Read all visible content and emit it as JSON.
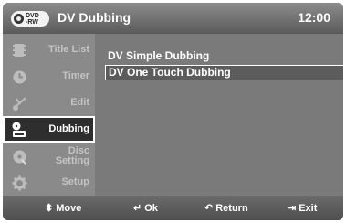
{
  "header": {
    "disc_badge": {
      "line1": "DVD",
      "line2": "-RW"
    },
    "title": "DV Dubbing",
    "time": "12:00"
  },
  "sidebar": {
    "items": [
      {
        "label": "Title List",
        "icon": "film-icon"
      },
      {
        "label": "Timer",
        "icon": "clock-icon"
      },
      {
        "label": "Edit",
        "icon": "scissors-icon"
      },
      {
        "label": "Dubbing",
        "icon": "dubbing-icon",
        "active": true
      },
      {
        "label": "Disc\nSetting",
        "icon": "disc-icon"
      },
      {
        "label": "Setup",
        "icon": "gear-icon"
      }
    ]
  },
  "options": [
    {
      "label": "DV Simple Dubbing"
    },
    {
      "label": "DV One Touch Dubbing",
      "selected": true
    }
  ],
  "footer": {
    "move": "Move",
    "ok": "Ok",
    "return": "Return",
    "exit": "Exit"
  }
}
